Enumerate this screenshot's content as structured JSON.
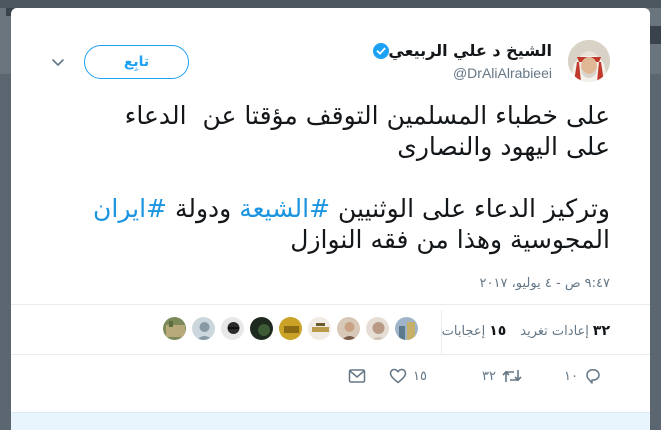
{
  "author": {
    "name": "الشيخ د علي الربيعي",
    "handle": "@DrAliAlrabieei",
    "verified": true
  },
  "follow_label": "تابِع",
  "tweet": {
    "line1": "على خطباء المسلمين التوقف مؤقتا عن  الدعاء",
    "line2": "على اليهود والنصارى",
    "line3_prefix": "وتركيز الدعاء على الوثنيين ",
    "hashtag1": "#الشيعة",
    "line3_middle": " ودولة ",
    "hashtag2": "#ايران",
    "line4": "المجوسية وهذا من فقه النوازل"
  },
  "timestamp": "٩:٤٧ ص - ٤ يوليو، ٢٠١٧",
  "stats": {
    "retweets_count": "٣٢",
    "retweets_label": "إعادات تغريد",
    "likes_count": "١٥",
    "likes_label": "إعجابات"
  },
  "actions": {
    "reply_count": "١٠",
    "retweet_count": "٣٢",
    "like_count": "١٥"
  },
  "colors": {
    "accent": "#1da1f2",
    "hashtag": "#1b95e0",
    "text": "#14171a",
    "muted": "#657786"
  },
  "icons": [
    "verified-badge-icon",
    "chevron-down-icon",
    "reply-icon",
    "retweet-icon",
    "heart-icon",
    "message-icon"
  ]
}
